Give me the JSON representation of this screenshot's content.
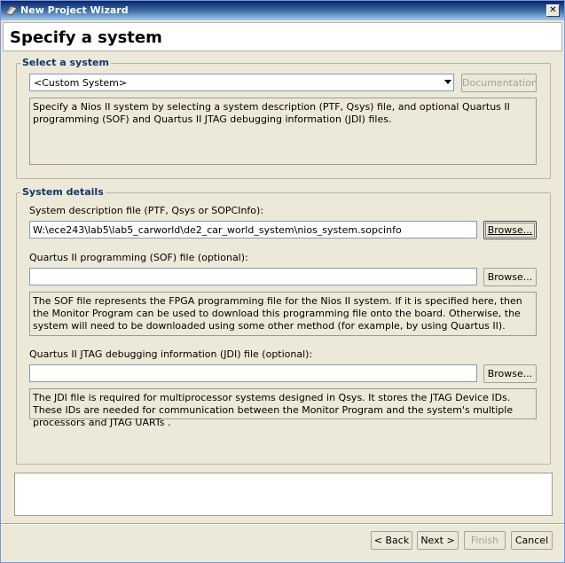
{
  "window": {
    "title": "New Project Wizard",
    "close_glyph": "✕"
  },
  "header": {
    "title": "Specify a system"
  },
  "select_system": {
    "group_label": "Select a system",
    "combo_value": "<Custom System>",
    "documentation_button": "Documentation",
    "description": "Specify a Nios II system by selecting a system description (PTF, Qsys) file, and optional Quartus II programming (SOF) and Quartus II JTAG debugging information (JDI) files."
  },
  "system_details": {
    "group_label": "System details",
    "sysdesc": {
      "label": "System description file (PTF, Qsys or SOPCInfo):",
      "value": "W:\\ece243\\lab5\\lab5_carworld\\de2_car_world_system\\nios_system.sopcinfo",
      "browse": "Browse..."
    },
    "sof": {
      "label": "Quartus II programming (SOF) file (optional):",
      "value": "",
      "browse": "Browse...",
      "info": "The SOF file represents the FPGA programming file for the Nios II system. If it is specified here, then the Monitor Program can be used to download this programming file onto the board. Otherwise, the system will need to be downloaded using some other method (for example, by using Quartus II)."
    },
    "jdi": {
      "label": "Quartus II JTAG debugging information (JDI) file (optional):",
      "value": "",
      "browse": "Browse...",
      "info": "The JDI file is required for multiprocessor systems designed in Qsys. It stores the JTAG Device IDs. These IDs are needed for communication between the Monitor Program and the system's multiple processors and JTAG UARTs ."
    }
  },
  "message_area": {
    "text": ""
  },
  "footer": {
    "back": "< Back",
    "next": "Next >",
    "finish": "Finish",
    "cancel": "Cancel"
  }
}
